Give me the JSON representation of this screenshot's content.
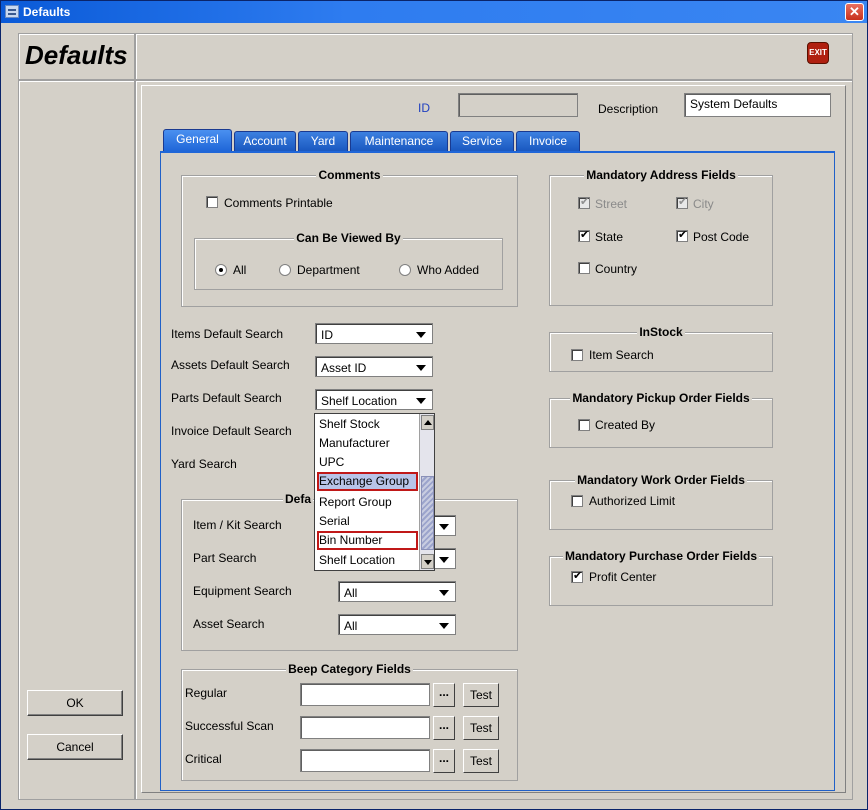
{
  "window": {
    "title": "Defaults",
    "close_label": "✕",
    "exit_label": "EXIT"
  },
  "header": {
    "title": "Defaults"
  },
  "id_row": {
    "id_label": "ID",
    "id_value": "",
    "description_label": "Description",
    "description_value": "System Defaults"
  },
  "tabs": [
    "General",
    "Account",
    "Yard",
    "Maintenance",
    "Service",
    "Invoice"
  ],
  "comments": {
    "title": "Comments",
    "printable_label": "Comments Printable",
    "printable_checked": false,
    "viewed_by": {
      "title": "Can Be Viewed By",
      "options": [
        "All",
        "Department",
        "Who Added"
      ],
      "selected": "All"
    }
  },
  "mandatory_address": {
    "title": "Mandatory Address Fields",
    "street": "Street",
    "city": "City",
    "state": "State",
    "post_code": "Post Code",
    "country": "Country"
  },
  "searches": {
    "items_label": "Items Default Search",
    "items_value": "ID",
    "assets_label": "Assets Default Search",
    "assets_value": "Asset ID",
    "parts_label": "Parts Default Search",
    "parts_value": "Shelf Location",
    "invoice_label": "Invoice Default Search",
    "yard_label": "Yard Search"
  },
  "dropdown_items": [
    "Shelf Stock",
    "Manufacturer",
    "UPC",
    "Exchange Group",
    "Report Group",
    "Serial",
    "Bin Number",
    "Shelf Location"
  ],
  "default_group": {
    "title": "Defa",
    "item_kit_label": "Item / Kit Search",
    "part_label": "Part Search",
    "equipment_label": "Equipment Search",
    "equipment_value": "All",
    "asset_label": "Asset Search",
    "asset_value": "All"
  },
  "instock": {
    "title": "InStock",
    "item_search": "Item Search"
  },
  "pickup": {
    "title": "Mandatory Pickup Order Fields",
    "created_by": "Created By"
  },
  "work_order": {
    "title": "Mandatory Work Order Fields",
    "authorized_limit": "Authorized Limit"
  },
  "purchase_order": {
    "title": "Mandatory Purchase Order Fields",
    "profit_center": "Profit Center"
  },
  "beep": {
    "title": "Beep Category Fields",
    "rows": [
      {
        "label": "Regular",
        "browse": "...",
        "test": "Test"
      },
      {
        "label": "Successful Scan",
        "browse": "...",
        "test": "Test"
      },
      {
        "label": "Critical",
        "browse": "...",
        "test": "Test"
      }
    ]
  },
  "buttons": {
    "ok": "OK",
    "cancel": "Cancel"
  }
}
